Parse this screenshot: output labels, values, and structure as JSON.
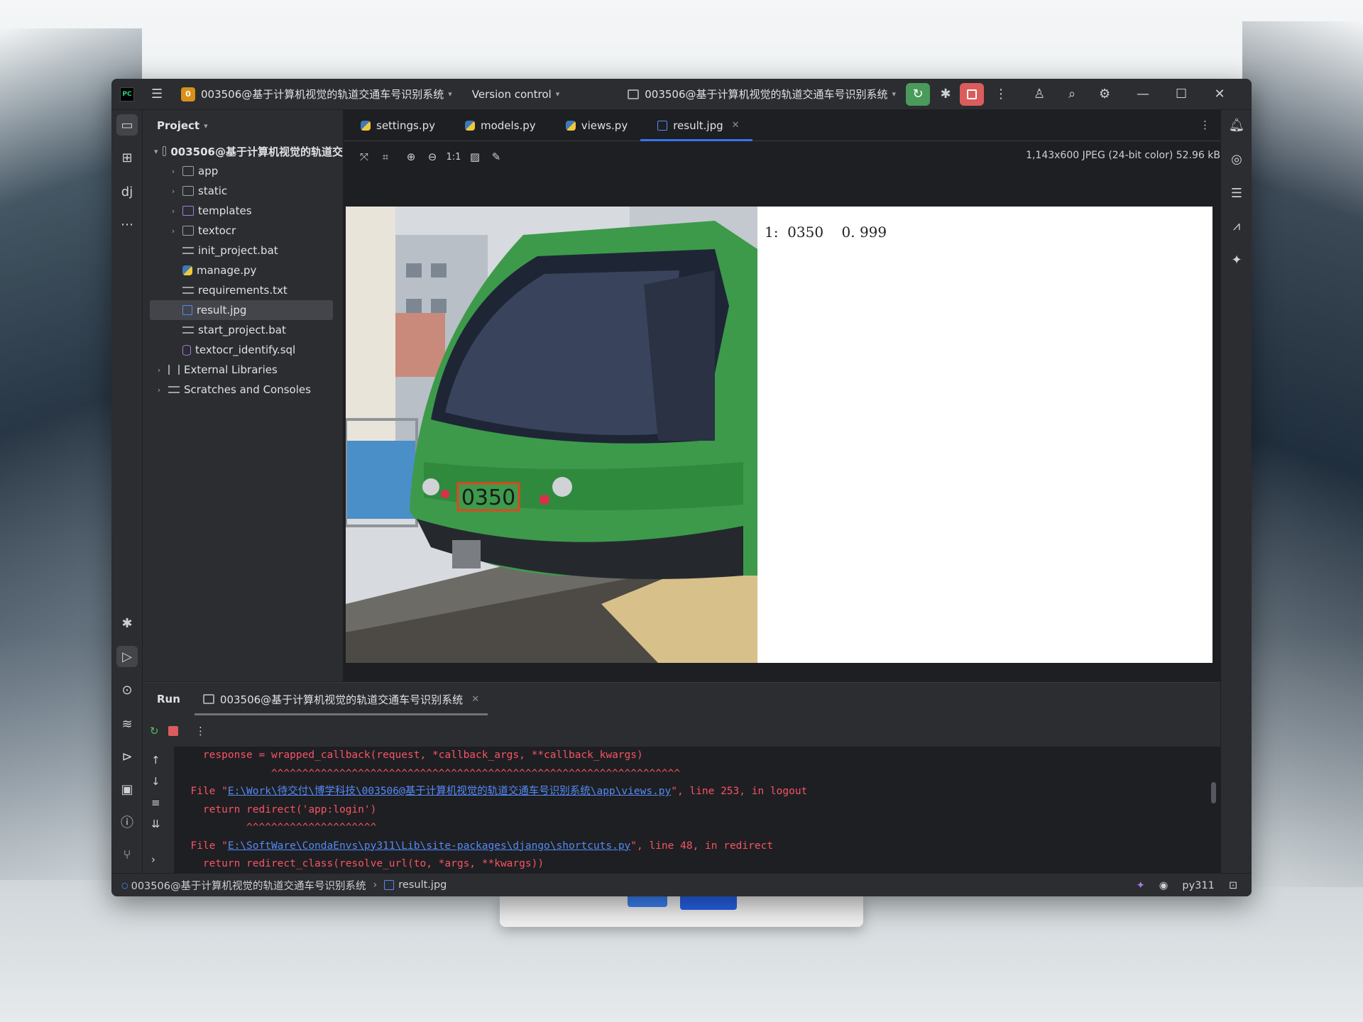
{
  "titlebar": {
    "logo": "PC",
    "project_badge": "0",
    "project_name": "003506@基于计算机视觉的轨道交通车号识别系统",
    "version_control": "Version control",
    "run_config": "003506@基于计算机视觉的轨道交通车号识别系统"
  },
  "project_panel": {
    "header": "Project",
    "root": "003506@基于计算机视觉的轨道交",
    "items": [
      {
        "label": "app"
      },
      {
        "label": "static"
      },
      {
        "label": "templates"
      },
      {
        "label": "textocr"
      },
      {
        "label": "init_project.bat"
      },
      {
        "label": "manage.py"
      },
      {
        "label": "requirements.txt"
      },
      {
        "label": "result.jpg"
      },
      {
        "label": "start_project.bat"
      },
      {
        "label": "textocr_identify.sql"
      },
      {
        "label": "External Libraries"
      },
      {
        "label": "Scratches and Consoles"
      }
    ]
  },
  "tabs": [
    {
      "label": "settings.py"
    },
    {
      "label": "models.py"
    },
    {
      "label": "views.py"
    },
    {
      "label": "result.jpg"
    }
  ],
  "image_toolbar": {
    "zoom_1to1": "1:1",
    "info": "1,143x600 JPEG (24-bit color) 52.96 kB"
  },
  "image": {
    "plate_number": "0350",
    "prediction": "1:  0350    0. 999"
  },
  "run_panel": {
    "title": "Run",
    "tab": "003506@基于计算机视觉的轨道交通车号识别系统",
    "lines": {
      "l1": "    response = wrapped_callback(request, *callback_args, **callback_kwargs)",
      "l2": "               ^^^^^^^^^^^^^^^^^^^^^^^^^^^^^^^^^^^^^^^^^^^^^^^^^^^^^^^^^^^^^^^^^^",
      "l3_pre": "  File \"",
      "l3_link": "E:\\Work\\待交付\\博学科技\\003506@基于计算机视觉的轨道交通车号识别系统\\app\\views.py",
      "l3_post": "\", line 253, in logout",
      "l4": "    return redirect('app:login')",
      "l5": "           ^^^^^^^^^^^^^^^^^^^^^",
      "l6_pre": "  File \"",
      "l6_link": "E:\\SoftWare\\CondaEnvs\\py311\\Lib\\site-packages\\django\\shortcuts.py",
      "l6_post": "\", line 48, in redirect",
      "l7": "    return redirect_class(resolve_url(to, *args, **kwargs))"
    }
  },
  "status": {
    "project": "003506@基于计算机视觉的轨道交通车号识别系统",
    "file": "result.jpg",
    "interpreter": "py311"
  }
}
